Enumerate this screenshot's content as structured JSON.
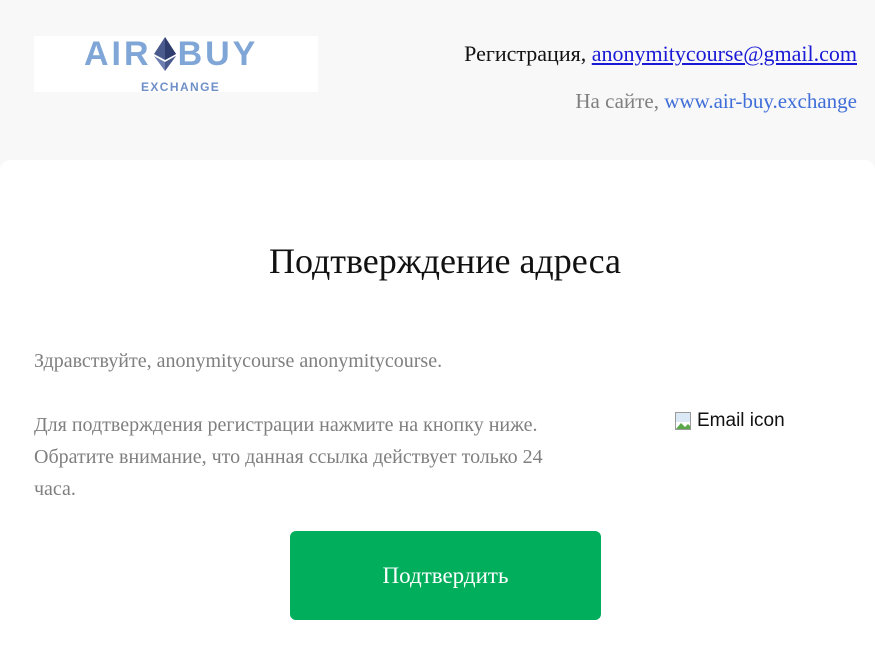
{
  "logo": {
    "word_left": "AIR",
    "word_right": "BUY",
    "subtitle": "EXCHANGE",
    "mark_icon": "ethereum-diamond-icon",
    "brand_color": "#7fa6d6"
  },
  "header": {
    "registration_label": "Регистрация,",
    "registration_email": "anonymitycourse@gmail.com",
    "site_label": "На сайте,",
    "site_url": "www.air-buy.exchange"
  },
  "main": {
    "title": "Подтверждение адреса",
    "greeting": "Здравствуйте, anonymitycourse anonymitycourse.",
    "body": "Для подтверждения регистрации нажмите на кнопку ниже. Обратите внимание, что данная ссылка действует только 24 часа.",
    "email_icon_alt": "Email icon",
    "confirm_button": "Подтвердить",
    "button_color": "#00ae5c"
  }
}
